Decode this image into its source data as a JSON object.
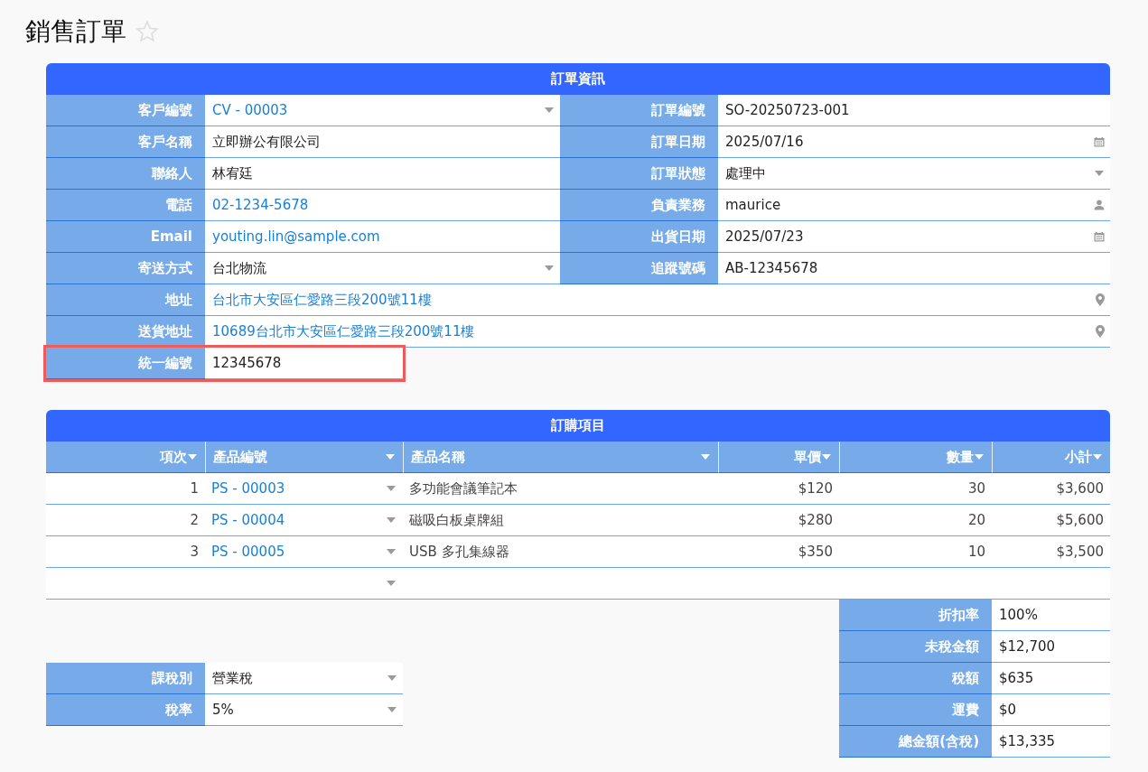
{
  "page": {
    "title": "銷售訂單",
    "favorite": false
  },
  "order_info": {
    "title": "訂單資訊",
    "rows": [
      {
        "cells": [
          {
            "label": "客戶編號",
            "value": "CV - 00003",
            "kind": "select",
            "link": true
          },
          {
            "label": "訂單編號",
            "value": "SO-20250723-001",
            "kind": "text",
            "link": false
          }
        ]
      },
      {
        "cells": [
          {
            "label": "客戶名稱",
            "value": "立即辦公有限公司",
            "kind": "text",
            "link": false
          },
          {
            "label": "訂單日期",
            "value": "2025/07/16",
            "kind": "date",
            "link": false
          }
        ]
      },
      {
        "cells": [
          {
            "label": "聯絡人",
            "value": "林宥廷",
            "kind": "text",
            "link": false
          },
          {
            "label": "訂單狀態",
            "value": "處理中",
            "kind": "select",
            "link": false
          }
        ]
      },
      {
        "cells": [
          {
            "label": "電話",
            "value": "02-1234-5678",
            "kind": "text",
            "link": true
          },
          {
            "label": "負責業務",
            "value": "maurice",
            "kind": "user",
            "link": false
          }
        ]
      },
      {
        "cells": [
          {
            "label": "Email",
            "value": "youting.lin@sample.com",
            "kind": "text",
            "link": true
          },
          {
            "label": "出貨日期",
            "value": "2025/07/23",
            "kind": "date",
            "link": false
          }
        ]
      },
      {
        "cells": [
          {
            "label": "寄送方式",
            "value": "台北物流",
            "kind": "select",
            "link": false
          },
          {
            "label": "追蹤號碼",
            "value": "AB-12345678",
            "kind": "text",
            "link": false
          }
        ]
      },
      {
        "cells": [
          {
            "label": "地址",
            "value": "台北市大安區仁愛路三段200號11樓",
            "kind": "address",
            "link": true
          }
        ]
      },
      {
        "cells": [
          {
            "label": "送貨地址",
            "value": "10689台北市大安區仁愛路三段200號11樓",
            "kind": "address",
            "link": true
          }
        ]
      }
    ],
    "tax_id": {
      "label": "統一編號",
      "value": "12345678",
      "highlighted": true
    }
  },
  "line_items": {
    "title": "訂購項目",
    "columns": [
      {
        "label": "項次",
        "kind": "number"
      },
      {
        "label": "產品編號",
        "kind": "text"
      },
      {
        "label": "產品名稱",
        "kind": "text"
      },
      {
        "label": "單價",
        "kind": "number"
      },
      {
        "label": "數量",
        "kind": "number"
      },
      {
        "label": "小計",
        "kind": "number"
      }
    ],
    "rows": [
      {
        "no": "1",
        "code": "PS - 00003",
        "name": "多功能會議筆記本",
        "price": "$120",
        "qty": "30",
        "subtotal": "$3,600"
      },
      {
        "no": "2",
        "code": "PS - 00004",
        "name": "磁吸白板桌牌組",
        "price": "$280",
        "qty": "20",
        "subtotal": "$5,600"
      },
      {
        "no": "3",
        "code": "PS - 00005",
        "name": "USB 多孔集線器",
        "price": "$350",
        "qty": "10",
        "subtotal": "$3,500"
      }
    ],
    "blank_row": true
  },
  "tax": [
    {
      "label": "課稅別",
      "value": "營業稅",
      "kind": "select"
    },
    {
      "label": "稅率",
      "value": "5%",
      "kind": "select"
    }
  ],
  "summary": [
    {
      "label": "折扣率",
      "value": "100%"
    },
    {
      "label": "未稅金額",
      "value": "$12,700"
    },
    {
      "label": "稅額",
      "value": "$635"
    },
    {
      "label": "運費",
      "value": "$0"
    },
    {
      "label": "總金額(含稅)",
      "value": "$13,335"
    }
  ]
}
